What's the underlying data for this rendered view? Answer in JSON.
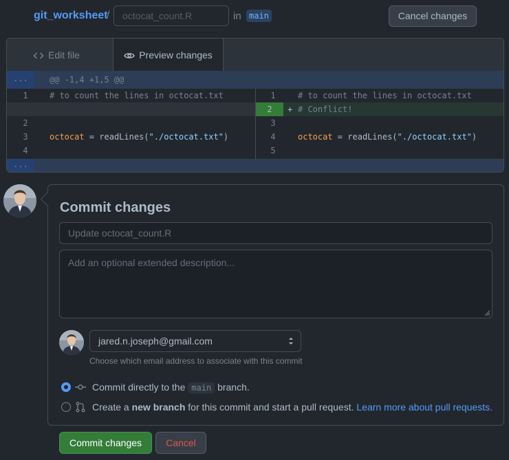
{
  "header": {
    "repo_name": "git_worksheet",
    "separator": "/",
    "filename_placeholder": "octocat_count.R",
    "in_label": "in",
    "branch": "main",
    "cancel_label": "Cancel changes"
  },
  "tabs": [
    {
      "label": "Edit file",
      "icon": "code-icon",
      "active": false
    },
    {
      "label": "Preview changes",
      "icon": "eye-icon",
      "active": true
    }
  ],
  "diff": {
    "expand_label": "...",
    "hunk_header": "@@ -1,4 +1,5 @@",
    "left": [
      {
        "num": "1",
        "code": "# to count the lines in octocat.txt"
      },
      {
        "num": "",
        "code": ""
      },
      {
        "num": "2",
        "code": ""
      },
      {
        "num": "3",
        "var": "octocat",
        "op": " = ",
        "fn": "readLines",
        "open": "(",
        "str": "\"./octocat.txt\"",
        "close": ")"
      },
      {
        "num": "4",
        "code": ""
      }
    ],
    "right": [
      {
        "num": "1",
        "code": "# to count the lines in octocat.txt"
      },
      {
        "num": "2",
        "marker": "+",
        "code": "# Conflict!"
      },
      {
        "num": "3",
        "code": ""
      },
      {
        "num": "4",
        "var": "octocat",
        "op": " = ",
        "fn": "readLines",
        "open": "(",
        "str": "\"./octocat.txt\"",
        "close": ")"
      },
      {
        "num": "5",
        "code": ""
      }
    ]
  },
  "commit": {
    "title": "Commit changes",
    "summary_placeholder": "Update octocat_count.R",
    "description_placeholder": "Add an optional extended description...",
    "email": "jared.n.joseph@gmail.com",
    "email_note": "Choose which email address to associate with this commit",
    "option_direct": {
      "prefix": "Commit directly to the",
      "branch": "main",
      "suffix": "branch.",
      "selected": true
    },
    "option_new": {
      "prefix": "Create a",
      "bold": "new branch",
      "suffix": "for this commit and start a pull request.",
      "link": "Learn more about pull requests.",
      "selected": false
    },
    "commit_button": "Commit changes",
    "cancel_button": "Cancel"
  },
  "colors": {
    "accent": "#539bf5",
    "commit_green": "#347d39",
    "danger": "#e5534b",
    "background": "#22272e"
  }
}
